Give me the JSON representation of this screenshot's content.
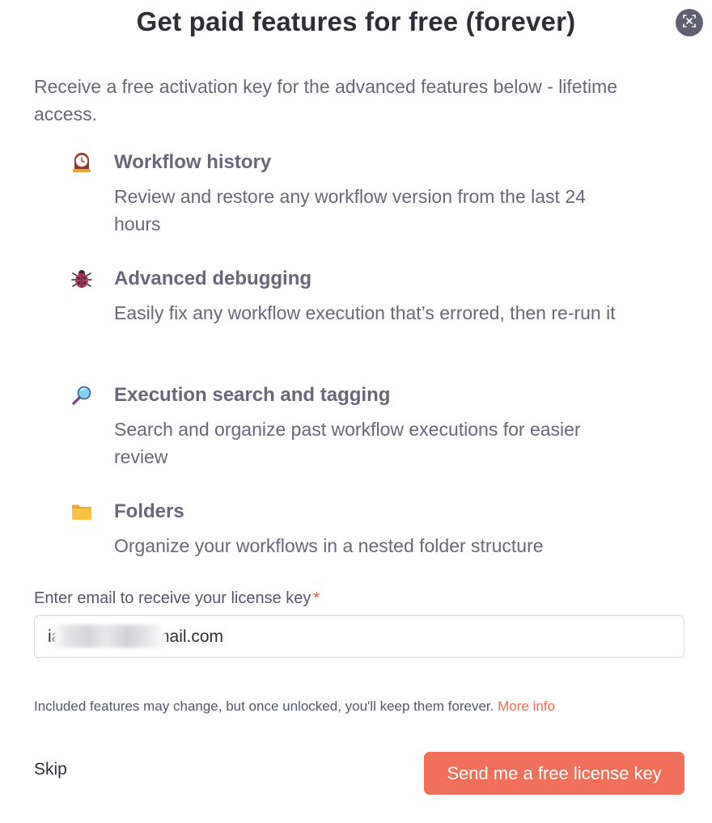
{
  "modal": {
    "title": "Get paid features for free (forever)",
    "close_icon": "close-icon",
    "subtitle": "Receive a free activation key for the advanced features below - lifetime access."
  },
  "features": [
    {
      "icon": "clock-icon",
      "title": "Workflow history",
      "description": "Review and restore any workflow version from the last 24 hours"
    },
    {
      "icon": "ladybug-icon",
      "title": "Advanced debugging",
      "description": "Easily fix any workflow execution that’s errored, then re-run it"
    },
    {
      "icon": "magnifying-glass-icon",
      "title": "Execution search and tagging",
      "description": "Search and organize past workflow executions for easier review"
    },
    {
      "icon": "folder-icon",
      "title": "Folders",
      "description": "Organize your workflows in a nested folder structure"
    }
  ],
  "form": {
    "email_label": "Enter email to receive your license key",
    "required_marker": "*",
    "email_value": "ia                    mail.com"
  },
  "footer": {
    "note": "Included features may change, but once unlocked, you'll keep them forever.",
    "more_info": "More info",
    "skip_label": "Skip",
    "send_label": "Send me a free license key"
  },
  "colors": {
    "accent": "#f0705c",
    "link": "#ee6c57",
    "required": "#e8543f",
    "text": "#676879"
  }
}
